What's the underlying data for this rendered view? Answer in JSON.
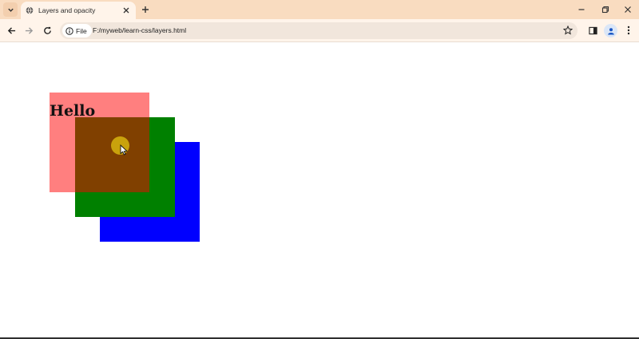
{
  "browser": {
    "tab": {
      "title": "Layers and opacity",
      "icon": "globe-icon"
    },
    "new_tab_icon": "plus-icon",
    "window_controls": [
      "minimize-icon",
      "restore-icon",
      "close-icon"
    ],
    "address": {
      "chip_label": "File",
      "chip_icon": "info-icon",
      "url": "F:/myweb/learn-css/layers.html"
    },
    "colors": {
      "tabstrip": "#f9dcc0",
      "toolbar": "#fff4ea",
      "omnibox": "#f1e6dc"
    }
  },
  "page": {
    "heading": "Hello",
    "boxes": [
      {
        "name": "red",
        "color": "#ff0000",
        "opacity": 0.5
      },
      {
        "name": "green",
        "color": "#008000"
      },
      {
        "name": "blue",
        "color": "#0000ff"
      }
    ],
    "cursor_highlight_color": "#c9a20c"
  }
}
